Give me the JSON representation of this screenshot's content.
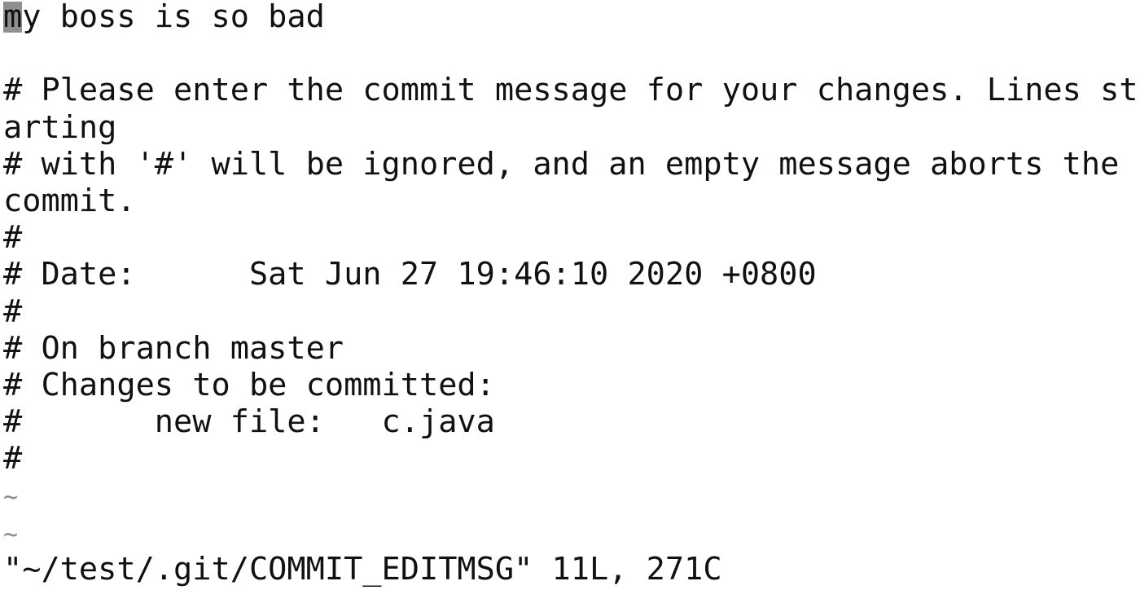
{
  "editor": {
    "mode": "vim",
    "cursor": {
      "row": 1,
      "col": 1
    },
    "lines": [
      "my boss is so bad",
      "",
      "# Please enter the commit message for your changes. Lines st",
      "arting",
      "# with '#' will be ignored, and an empty message aborts the",
      "commit.",
      "#",
      "# Date:      Sat Jun 27 19:46:10 2020 +0800",
      "#",
      "# On branch master",
      "# Changes to be committed:",
      "#       new file:   c.java",
      "#"
    ],
    "empty_markers": [
      "~",
      "~"
    ],
    "status_line": "\"~/test/.git/COMMIT_EDITMSG\" 11L, 271C"
  }
}
